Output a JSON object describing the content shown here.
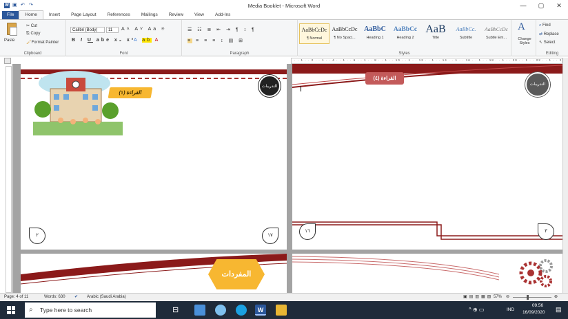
{
  "window": {
    "title": "Media Booklet - Microsoft Word",
    "controls": [
      "—",
      "▢",
      "✕"
    ]
  },
  "tabs": [
    "File",
    "Home",
    "Insert",
    "Page Layout",
    "References",
    "Mailings",
    "Review",
    "View",
    "Add-Ins"
  ],
  "clipboard": {
    "paste": "Paste",
    "cut": "Cut",
    "copy": "Copy",
    "format_painter": "Format Painter",
    "label": "Clipboard"
  },
  "font": {
    "name": "Calibri (Body)",
    "size": "11",
    "label": "Font"
  },
  "paragraph": {
    "label": "Paragraph"
  },
  "styles": {
    "label": "Styles",
    "items": [
      {
        "sample": "AaBbCcDc",
        "name": "¶ Normal"
      },
      {
        "sample": "AaBbCcDc",
        "name": "¶ No Spaci..."
      },
      {
        "sample": "AaBbC",
        "name": "Heading 1"
      },
      {
        "sample": "AaBbCc",
        "name": "Heading 2"
      },
      {
        "sample": "AaB",
        "name": "Title"
      },
      {
        "sample": "AaBbCc.",
        "name": "Subtitle"
      },
      {
        "sample": "AaBbCcDc",
        "name": "Subtle Em..."
      }
    ],
    "change": "Change Styles"
  },
  "editing": {
    "find": "Find",
    "replace": "Replace",
    "select": "Select",
    "label": "Editing"
  },
  "ruler": "· · 1 · · 2 · · 1 · · 4 · · 1 · · 6 · · 1 · · 8 · · 1 · · 10 · · 1 · · 12 · · 1 · · 14 · · 1 · · 16 · · 1 · · 18 · · 1 · · 20 · · 1 · · 22 · · 1 · · 24 · · 1 · · 26 · · 1 · 28",
  "pages": {
    "p1": {
      "badge": "التدريبات",
      "heading": "القراءة (١)",
      "page_num": "٢",
      "page_num2": "١٧"
    },
    "p2": {
      "badge": "التدريبات",
      "heading": "القراءة (٤)",
      "page_num": "١٦",
      "page_num2": "٣"
    },
    "p3": {
      "heading": "المفردات"
    }
  },
  "status": {
    "page": "Page: 4 of 11",
    "words": "Words: 630",
    "language": "Arabic (Saudi Arabia)",
    "zoom": "57%"
  },
  "taskbar": {
    "search": "Type here to search",
    "lang": "IND",
    "time": "09.56",
    "date": "16/09/2020"
  },
  "colors": {
    "accent": "#2b579a",
    "maroon": "#8b1a1a",
    "taskbar": "#1f2b3a",
    "yellow": "#f7b731"
  }
}
